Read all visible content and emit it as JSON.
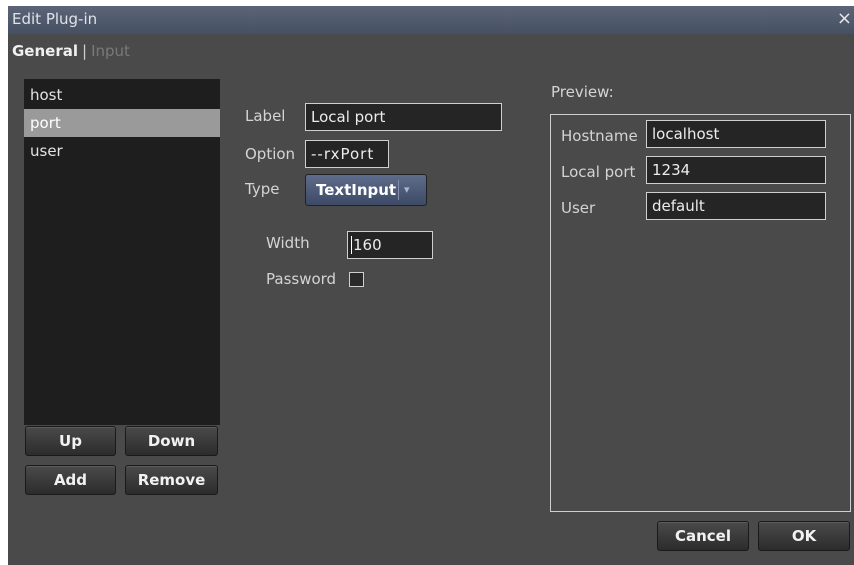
{
  "window": {
    "title": "Edit Plug-in",
    "close_symbol": "×"
  },
  "tabs": {
    "general": "General",
    "separator": "|",
    "input": "Input"
  },
  "param_list": {
    "items": [
      {
        "label": "host",
        "selected": false
      },
      {
        "label": "port",
        "selected": true
      },
      {
        "label": "user",
        "selected": false
      }
    ]
  },
  "list_buttons": {
    "up": "Up",
    "down": "Down",
    "add": "Add",
    "remove": "Remove"
  },
  "editor": {
    "label_caption": "Label",
    "label_value": "Local port",
    "option_caption": "Option",
    "option_value": "--rxPort",
    "type_caption": "Type",
    "type_value": "TextInput",
    "width_caption": "Width",
    "width_value": "160",
    "password_caption": "Password",
    "password_checked": false
  },
  "preview": {
    "caption": "Preview:",
    "rows": [
      {
        "label": "Hostname",
        "value": "localhost"
      },
      {
        "label": "Local port",
        "value": "1234"
      },
      {
        "label": "User",
        "value": "default"
      }
    ]
  },
  "footer": {
    "cancel": "Cancel",
    "ok": "OK"
  },
  "colors": {
    "window_bg": "#4a4a4a",
    "titlebar": "#465063",
    "selected_item": "#9a9a9a",
    "dropdown": "#3d4a66"
  }
}
